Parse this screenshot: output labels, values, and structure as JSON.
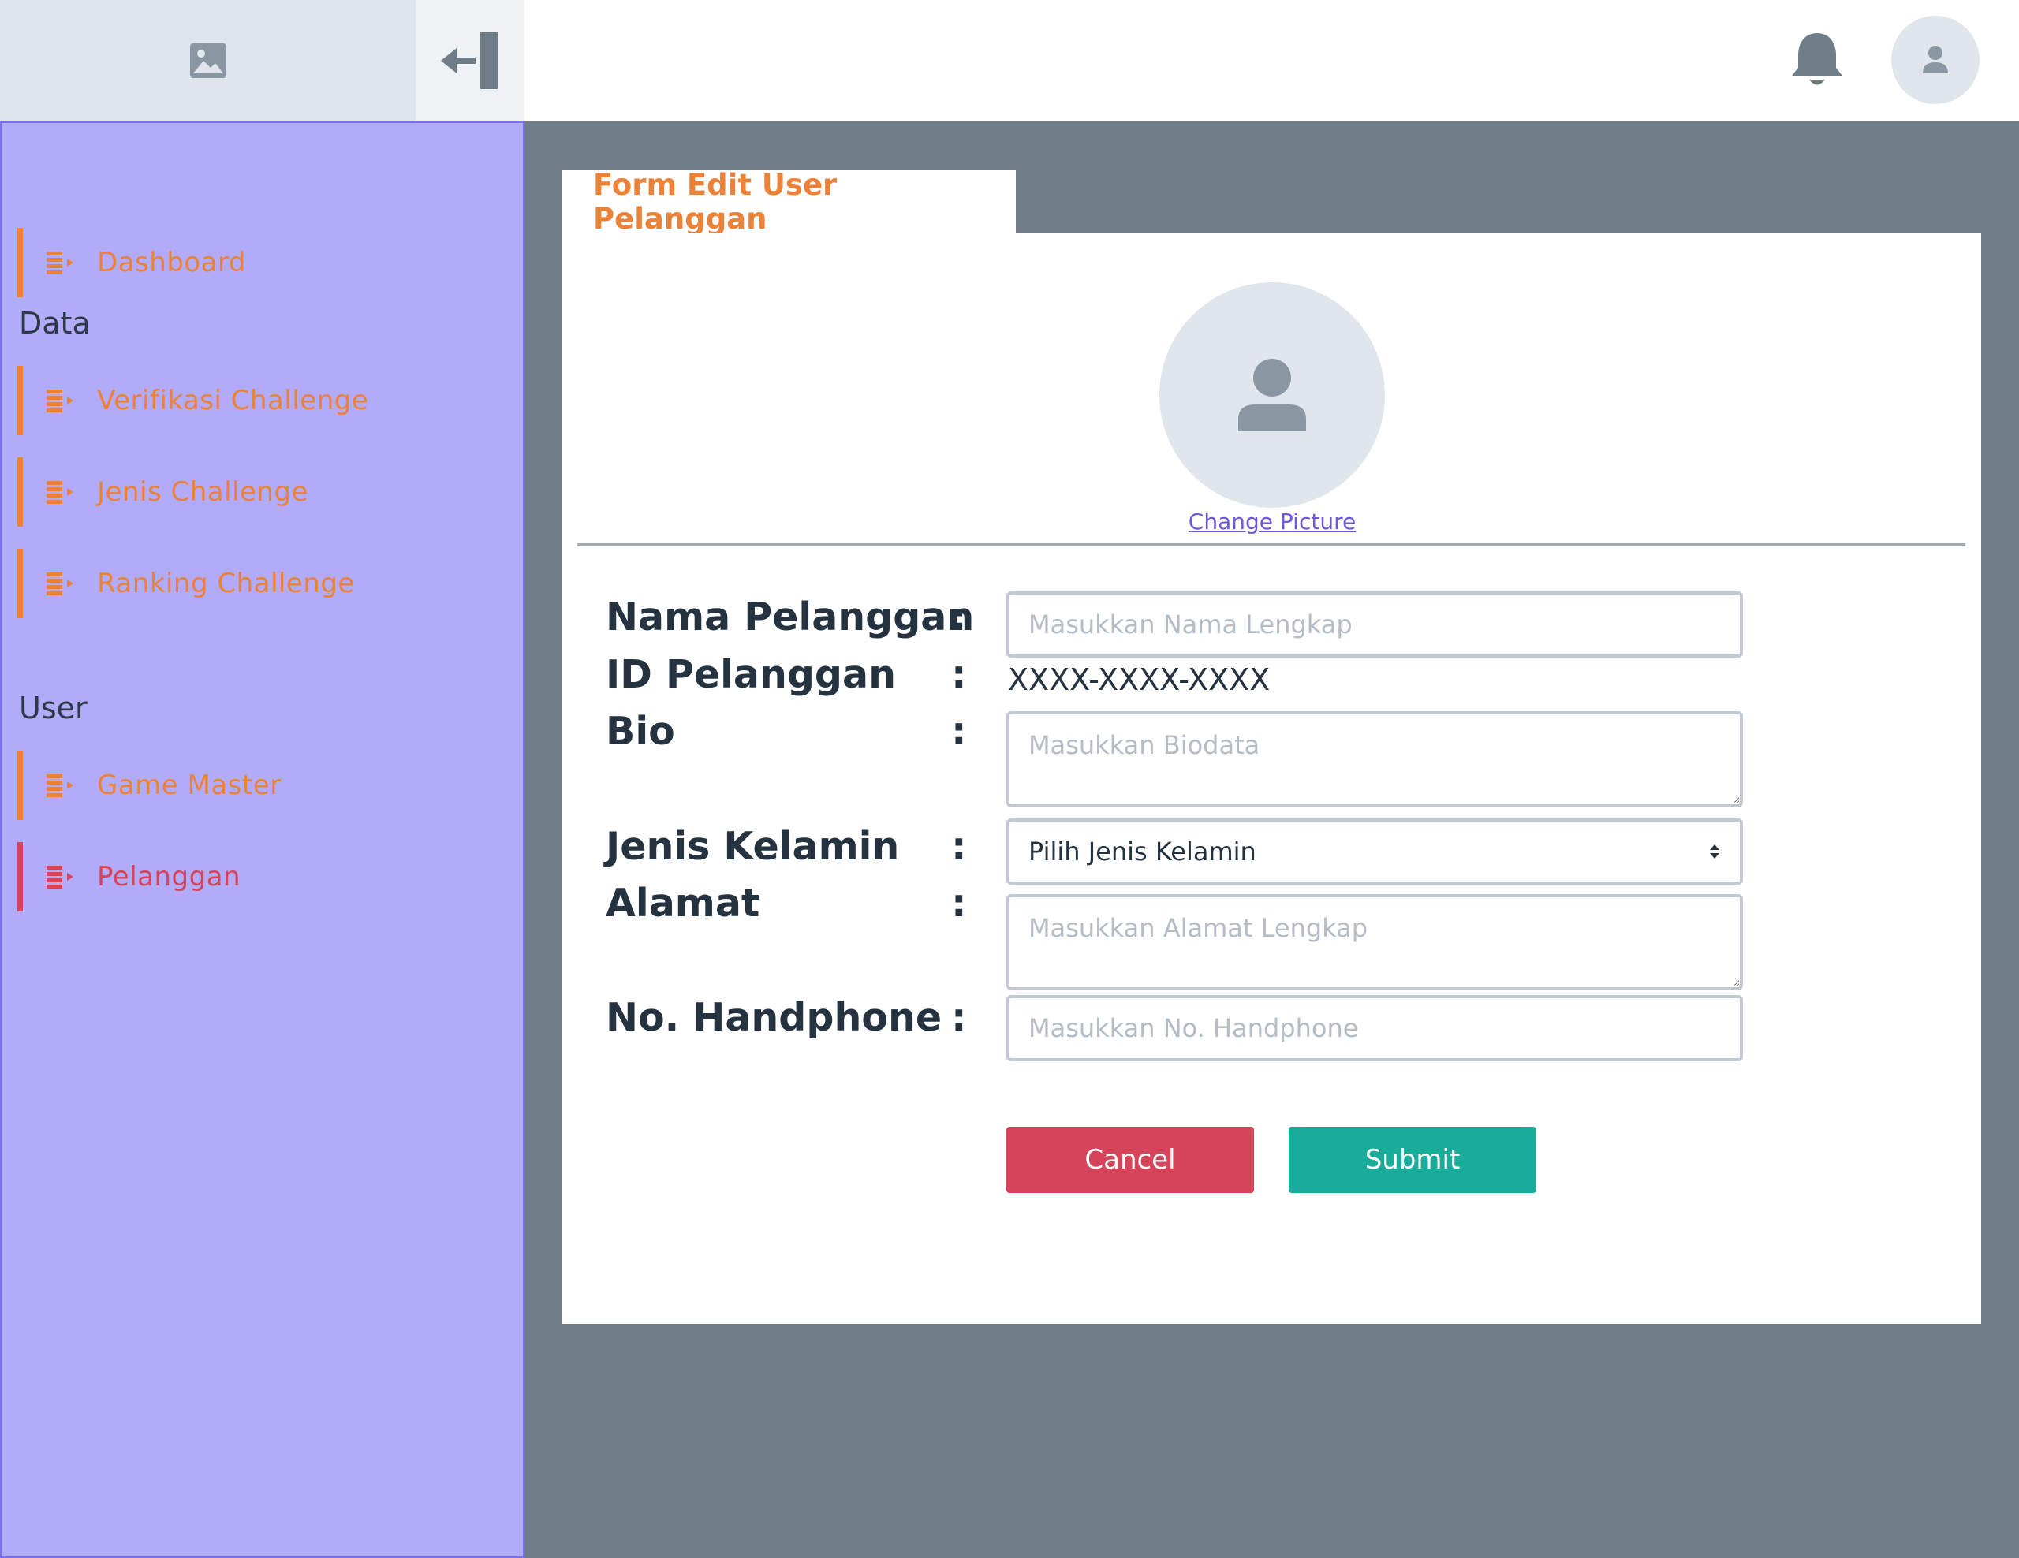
{
  "header": {
    "logo_icon": "image-placeholder-icon",
    "collapse_icon": "collapse-sidebar-icon",
    "notification_icon": "bell-icon",
    "avatar_icon": "user-icon"
  },
  "sidebar": {
    "items": [
      {
        "label": "Dashboard",
        "icon": "list-arrow-icon",
        "active": false
      },
      {
        "label": "Verifikasi Challenge",
        "icon": "list-arrow-icon",
        "active": false
      },
      {
        "label": "Jenis Challenge",
        "icon": "list-arrow-icon",
        "active": false
      },
      {
        "label": "Ranking Challenge",
        "icon": "list-arrow-icon",
        "active": false
      },
      {
        "label": "Game Master",
        "icon": "list-arrow-icon",
        "active": false
      },
      {
        "label": "Pelanggan",
        "icon": "list-arrow-icon",
        "active": true
      }
    ],
    "sections": {
      "data": "Data",
      "user": "User"
    }
  },
  "form": {
    "tab_title": "Form Edit User Pelanggan",
    "change_picture": "Change Picture",
    "colon": ":",
    "fields": {
      "nama": {
        "label": "Nama Pelanggan",
        "placeholder": "Masukkan Nama Lengkap",
        "value": ""
      },
      "id": {
        "label": "ID Pelanggan",
        "value": "XXXX-XXXX-XXXX"
      },
      "bio": {
        "label": "Bio",
        "placeholder": "Masukkan Biodata",
        "value": ""
      },
      "gender": {
        "label": "Jenis Kelamin",
        "selected": "Pilih Jenis Kelamin"
      },
      "alamat": {
        "label": "Alamat",
        "placeholder": "Masukkan Alamat Lengkap",
        "value": ""
      },
      "phone": {
        "label": "No. Handphone",
        "placeholder": "Masukkan No. Handphone",
        "value": ""
      }
    },
    "cancel_label": "Cancel",
    "submit_label": "Submit"
  },
  "colors": {
    "accent_orange": "#ec8238",
    "active_red": "#d64459",
    "submit_teal": "#1aac9b",
    "sidebar_bg": "#b2abf9",
    "content_bg": "#6f7d88",
    "link_purple": "#6d58de"
  }
}
